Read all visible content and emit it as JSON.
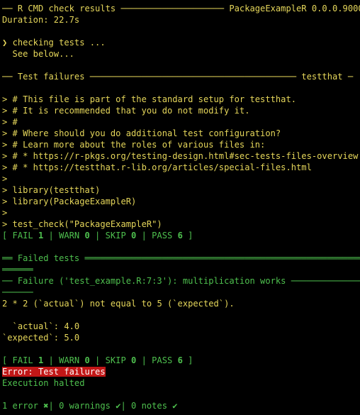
{
  "header": {
    "rule_prefix": "── ",
    "title": "R CMD check results",
    "rule_mid": " ──────────────────── ",
    "package": "PackageExampleR",
    "version": " 0.0.0.9000 ──",
    "duration": "Duration: 22.7s"
  },
  "checking": {
    "arrow": "❯ ",
    "text": "checking tests ...",
    "see_below": "  See below..."
  },
  "failures_section": {
    "rule_left": "── ",
    "title": "Test failures",
    "rule_mid": " ──────────────────────────────────────── ",
    "tag": "testthat",
    "rule_right": " ─"
  },
  "code": [
    "> # This file is part of the standard setup for testthat.",
    "> # It is recommended that you do not modify it.",
    "> #",
    "> # Where should you do additional test configuration?",
    "> # Learn more about the roles of various files in:",
    "> # * https://r-pkgs.org/testing-design.html#sec-tests-files-overview",
    "> # * https://testthat.r-lib.org/articles/special-files.html",
    ">",
    "> library(testthat)",
    "> library(PackageExampleR)",
    ">",
    "> test_check(\"PackageExampleR\")"
  ],
  "summary": {
    "open": "[ FAIL ",
    "fail": "1",
    "warn_label": " | WARN ",
    "warn": "0",
    "skip_label": " | SKIP ",
    "skip": "0",
    "pass_label": " | PASS ",
    "pass": "6",
    "close": " ]"
  },
  "failed_tests": {
    "title": "══ Failed tests ═══════════════════════════════════════════════════════",
    "wrap": "══════"
  },
  "failure": {
    "prefix": "── Failure ('",
    "location": "test_example.R:7:3",
    "suffix": "'): multiplication works ──────────────────",
    "wrap": "──────",
    "message_a": "2",
    "message_b": " * ",
    "message_c": "2",
    "message_d": " (`actual`) not equal to ",
    "message_e": "5",
    "message_f": " (`expected`).",
    "actual_label": "  `actual`: ",
    "actual_value": "4.0",
    "expected_label": "`expected`: ",
    "expected_value": "5.0"
  },
  "error": {
    "label": "Error: Test failures",
    "halted": "Execution halted"
  },
  "footer": {
    "errors_count": "1",
    "errors_label": " error ",
    "errors_mark": "✖",
    "sep1": "| ",
    "warnings_count": "0",
    "warnings_label": " warnings ",
    "warnings_mark": "✔",
    "sep2": "| ",
    "notes_count": "0",
    "notes_label": " notes ",
    "notes_mark": "✔"
  }
}
